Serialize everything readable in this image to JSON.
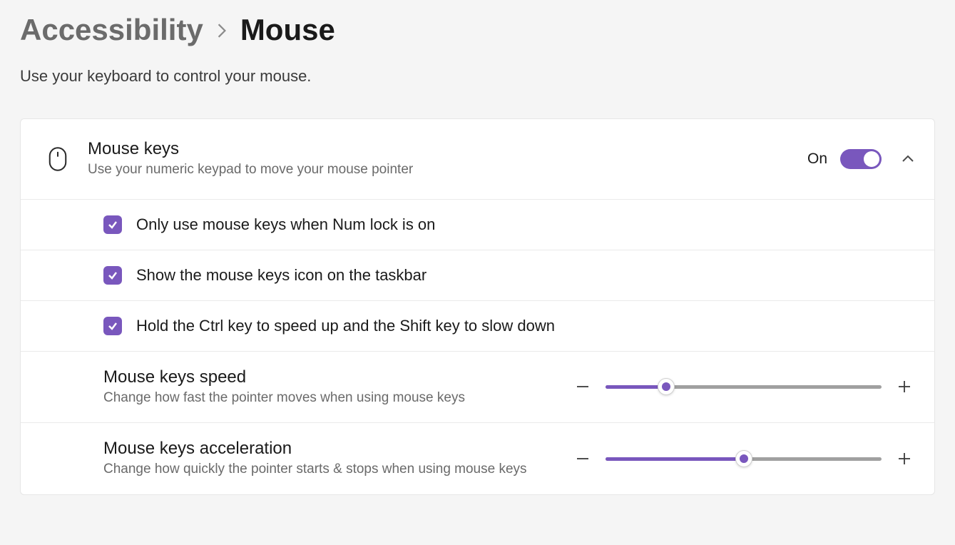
{
  "colors": {
    "accent": "#7957bd"
  },
  "breadcrumb": {
    "parent": "Accessibility",
    "current": "Mouse"
  },
  "subtitle": "Use your keyboard to control your mouse.",
  "mouseKeys": {
    "title": "Mouse keys",
    "desc": "Use your numeric keypad to move your mouse pointer",
    "state_label": "On",
    "enabled": true
  },
  "options": {
    "numlock": {
      "checked": true,
      "label": "Only use mouse keys when Num lock is on"
    },
    "taskbar": {
      "checked": true,
      "label": "Show the mouse keys icon on the taskbar"
    },
    "ctrlshift": {
      "checked": true,
      "label": "Hold the Ctrl key to speed up and the Shift key to slow down"
    }
  },
  "speed": {
    "title": "Mouse keys speed",
    "desc": "Change how fast the pointer moves when using mouse keys",
    "value": 22
  },
  "accel": {
    "title": "Mouse keys acceleration",
    "desc": "Change how quickly the pointer starts & stops when using mouse keys",
    "value": 50
  }
}
